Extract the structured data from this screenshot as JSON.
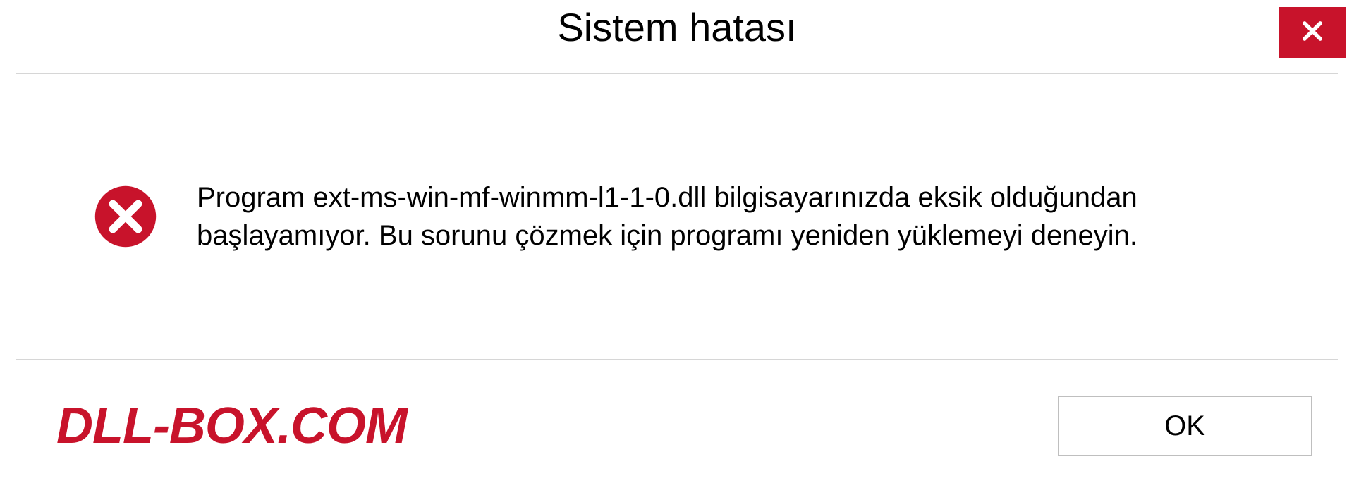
{
  "titlebar": {
    "title": "Sistem hatası"
  },
  "dialog": {
    "message": "Program ext-ms-win-mf-winmm-l1-1-0.dll bilgisayarınızda eksik olduğundan başlayamıyor. Bu sorunu çözmek için programı yeniden yüklemeyi deneyin."
  },
  "buttons": {
    "ok_label": "OK"
  },
  "watermark": {
    "text": "DLL-BOX.COM"
  },
  "colors": {
    "close_button_bg": "#c8132b",
    "error_icon_bg": "#c8132b",
    "watermark_color": "#c8132b"
  }
}
